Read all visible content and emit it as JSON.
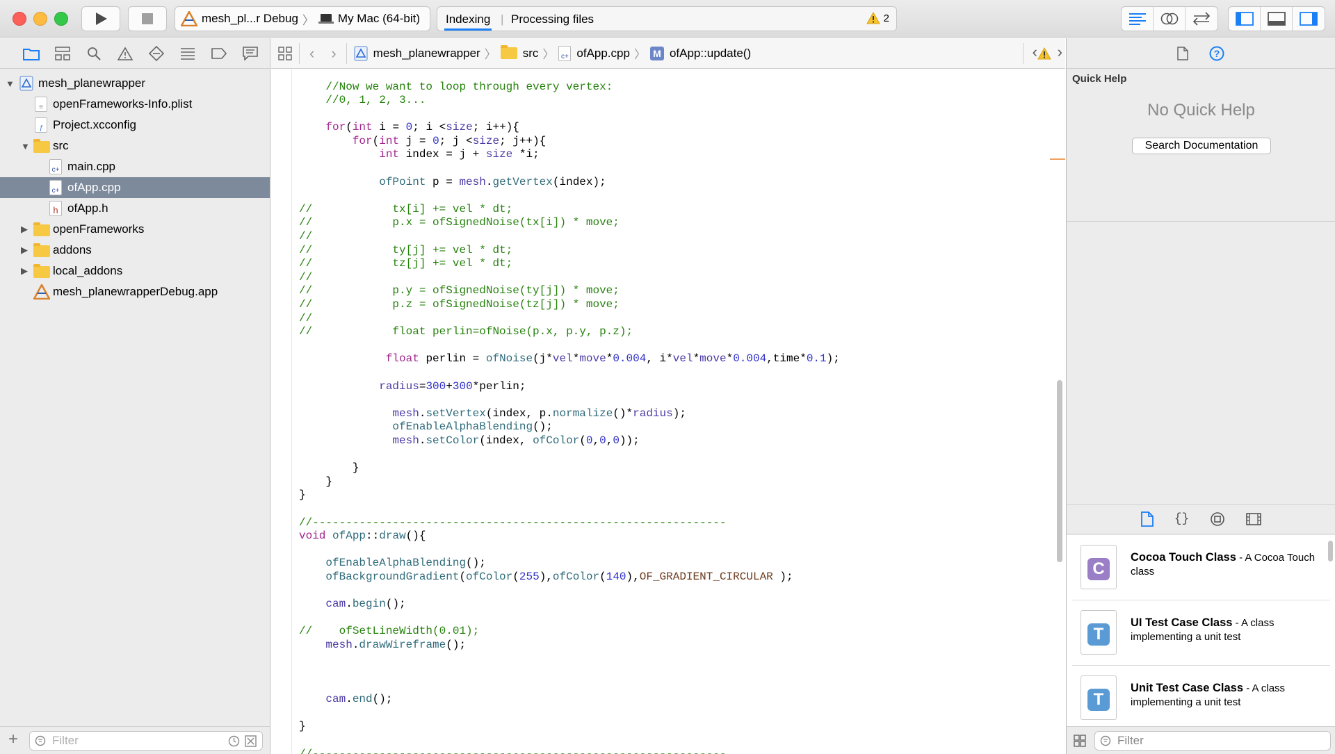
{
  "toolbar": {
    "scheme_target": "mesh_pl...r Debug",
    "destination": "My Mac (64-bit)",
    "activity_project": "Indexing",
    "activity_status": "Processing files",
    "warning_count": "2"
  },
  "navigator": {
    "items": [
      {
        "label": "mesh_planewrapper"
      },
      {
        "label": "openFrameworks-Info.plist"
      },
      {
        "label": "Project.xcconfig"
      },
      {
        "label": "src"
      },
      {
        "label": "main.cpp"
      },
      {
        "label": "ofApp.cpp"
      },
      {
        "label": "ofApp.h"
      },
      {
        "label": "openFrameworks"
      },
      {
        "label": "addons"
      },
      {
        "label": "local_addons"
      },
      {
        "label": "mesh_planewrapperDebug.app"
      }
    ],
    "filter_placeholder": "Filter"
  },
  "jumpbar": {
    "project": "mesh_planewrapper",
    "group": "src",
    "file": "ofApp.cpp",
    "method_badge": "M",
    "method": "ofApp::update()"
  },
  "inspector": {
    "quick_help_title": "Quick Help",
    "no_quick_help": "No Quick Help",
    "search_docs": "Search Documentation",
    "library": [
      {
        "glyph": "C",
        "title": "Cocoa Touch Class",
        "desc": "- A Cocoa Touch class",
        "color": "#9b7fc6"
      },
      {
        "glyph": "T",
        "title": "UI Test Case Class",
        "desc": "- A class implementing a unit test",
        "color": "#5a9bd5"
      },
      {
        "glyph": "T",
        "title": "Unit Test Case Class",
        "desc": "- A class implementing a unit test",
        "color": "#5a9bd5"
      }
    ],
    "filter_placeholder": "Filter"
  },
  "colors": {
    "selection": "#7d8a9c",
    "accent": "#1a7ff5",
    "comment": "#26820d",
    "keyword": "#a4268e",
    "number": "#2f30c7"
  }
}
